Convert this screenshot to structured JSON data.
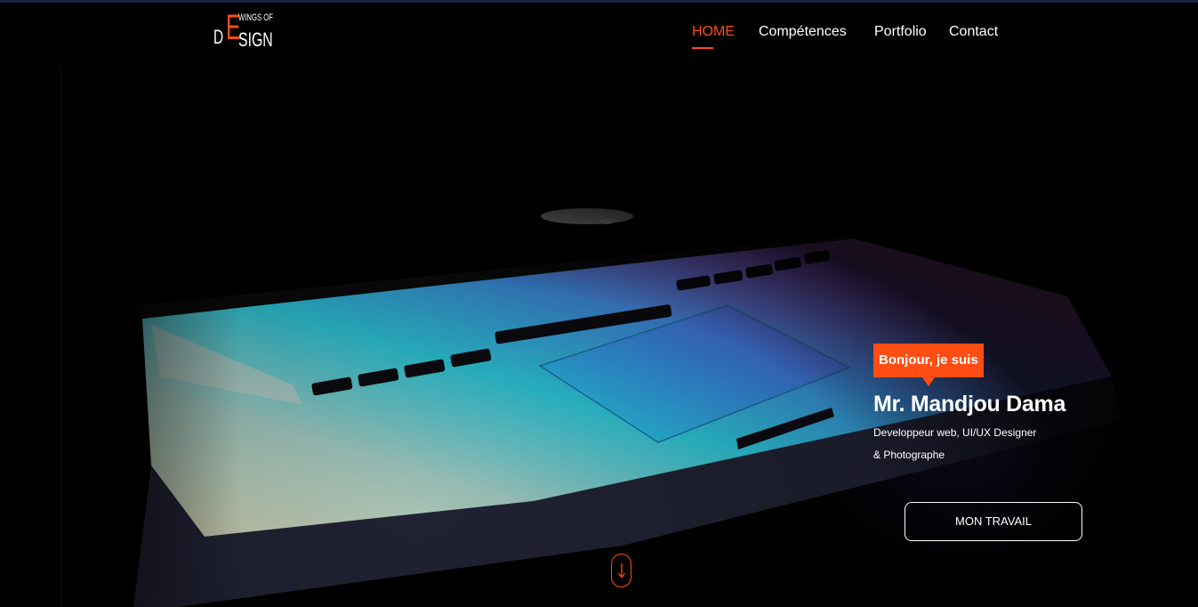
{
  "header": {
    "logo": {
      "wings": "WINGS OF",
      "letter_d": "D",
      "letter_e": "E",
      "sign": "SIGN"
    },
    "nav": {
      "home": "HOME",
      "skills": "Compétences",
      "portfolio": "Portfolio",
      "contact": "Contact"
    }
  },
  "hero": {
    "greeting": "Bonjour, je suis",
    "name": "Mr. Mandjou Dama",
    "role_line1": "Developpeur web, UI/UX Designer",
    "role_line2": "& Photographe",
    "cta_label": "MON TRAVAIL",
    "scroll_icon": "arrow-down-icon"
  },
  "colors": {
    "accent": "#ff4d14",
    "background": "#000000",
    "text": "#ffffff"
  }
}
